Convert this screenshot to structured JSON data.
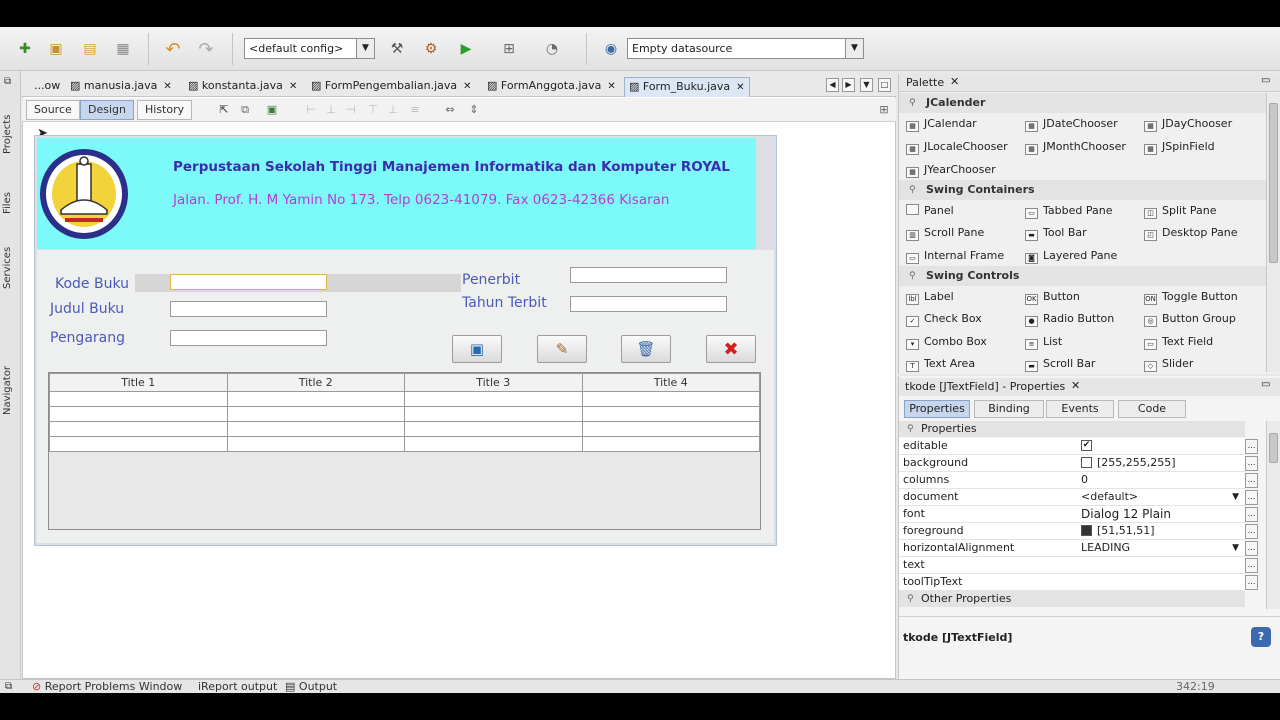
{
  "toolbar": {
    "config_value": "<default config>",
    "datasource_value": "Empty datasource",
    "icons": [
      "new-file-icon",
      "new-project-icon",
      "open-project-icon",
      "close-project-icon",
      "undo-icon",
      "redo-icon",
      "build-icon",
      "clean-build-icon",
      "run-icon",
      "debug-icon",
      "profile-icon",
      "datasource-icon"
    ]
  },
  "left_strip": {
    "tabs": [
      "Projects",
      "Files",
      "Services",
      "Navigator"
    ]
  },
  "editor": {
    "tabs": [
      "...ow",
      "manusia.java",
      "konstanta.java",
      "FormPengembalian.java",
      "FormAnggota.java",
      "Form_Buku.java"
    ],
    "active_tab": "Form_Buku.java",
    "view_buttons": {
      "source": "Source",
      "design": "Design",
      "history": "History"
    }
  },
  "form": {
    "header_title": "Perpustaan Sekolah Tinggi Manajemen Informatika dan Komputer ROYAL",
    "header_address": "Jalan. Prof. H. M Yamin No 173. Telp 0623-41079. Fax 0623-42366 Kisaran",
    "colors": {
      "header_bg": "#7cfafa",
      "title": "#3d2cb0",
      "address": "#b93ad6",
      "label": "#4a5ab8"
    },
    "labels": {
      "kode_buku": "Kode Buku",
      "judul_buku": "Judul Buku",
      "pengarang": "Pengarang",
      "penerbit": "Penerbit",
      "tahun_terbit": "Tahun Terbit"
    },
    "buttons": [
      "save-icon",
      "edit-icon",
      "delete-icon",
      "close-icon"
    ],
    "table": {
      "headers": [
        "Title 1",
        "Title 2",
        "Title 3",
        "Title 4"
      ],
      "rows": [
        [
          "",
          "",
          "",
          ""
        ],
        [
          "",
          "",
          "",
          ""
        ],
        [
          "",
          "",
          "",
          ""
        ],
        [
          "",
          "",
          "",
          ""
        ]
      ]
    }
  },
  "palette": {
    "title": "Palette",
    "groups": [
      {
        "name": "JCalender",
        "items": [
          "JCalendar",
          "JDateChooser",
          "JDayChooser",
          "JLocaleChooser",
          "JMonthChooser",
          "JSpinField",
          "JYearChooser"
        ]
      },
      {
        "name": "Swing Containers",
        "items": [
          "Panel",
          "Tabbed Pane",
          "Split Pane",
          "Scroll Pane",
          "Tool Bar",
          "Desktop Pane",
          "Internal Frame",
          "Layered Pane"
        ]
      },
      {
        "name": "Swing Controls",
        "items": [
          "Label",
          "Button",
          "Toggle Button",
          "Check Box",
          "Radio Button",
          "Button Group",
          "Combo Box",
          "List",
          "Text Field",
          "Text Area",
          "Scroll Bar",
          "Slider"
        ]
      }
    ]
  },
  "properties": {
    "title": "tkode [JTextField] - Properties",
    "tabs": [
      "Properties",
      "Binding",
      "Events",
      "Code"
    ],
    "section": "Properties",
    "rows": [
      {
        "name": "editable",
        "value": "✔"
      },
      {
        "name": "background",
        "value": "[255,255,255]"
      },
      {
        "name": "columns",
        "value": "0"
      },
      {
        "name": "document",
        "value": "<default>"
      },
      {
        "name": "font",
        "value": "Dialog 12 Plain"
      },
      {
        "name": "foreground",
        "value": "[51,51,51]"
      },
      {
        "name": "horizontalAlignment",
        "value": "LEADING"
      },
      {
        "name": "text",
        "value": ""
      },
      {
        "name": "toolTipText",
        "value": ""
      }
    ],
    "other_section": "Other Properties",
    "footer": "tkode [JTextField]"
  },
  "statusbar": {
    "items": [
      "Report Problems Window",
      "iReport output",
      "Output"
    ],
    "position": "342:19"
  }
}
